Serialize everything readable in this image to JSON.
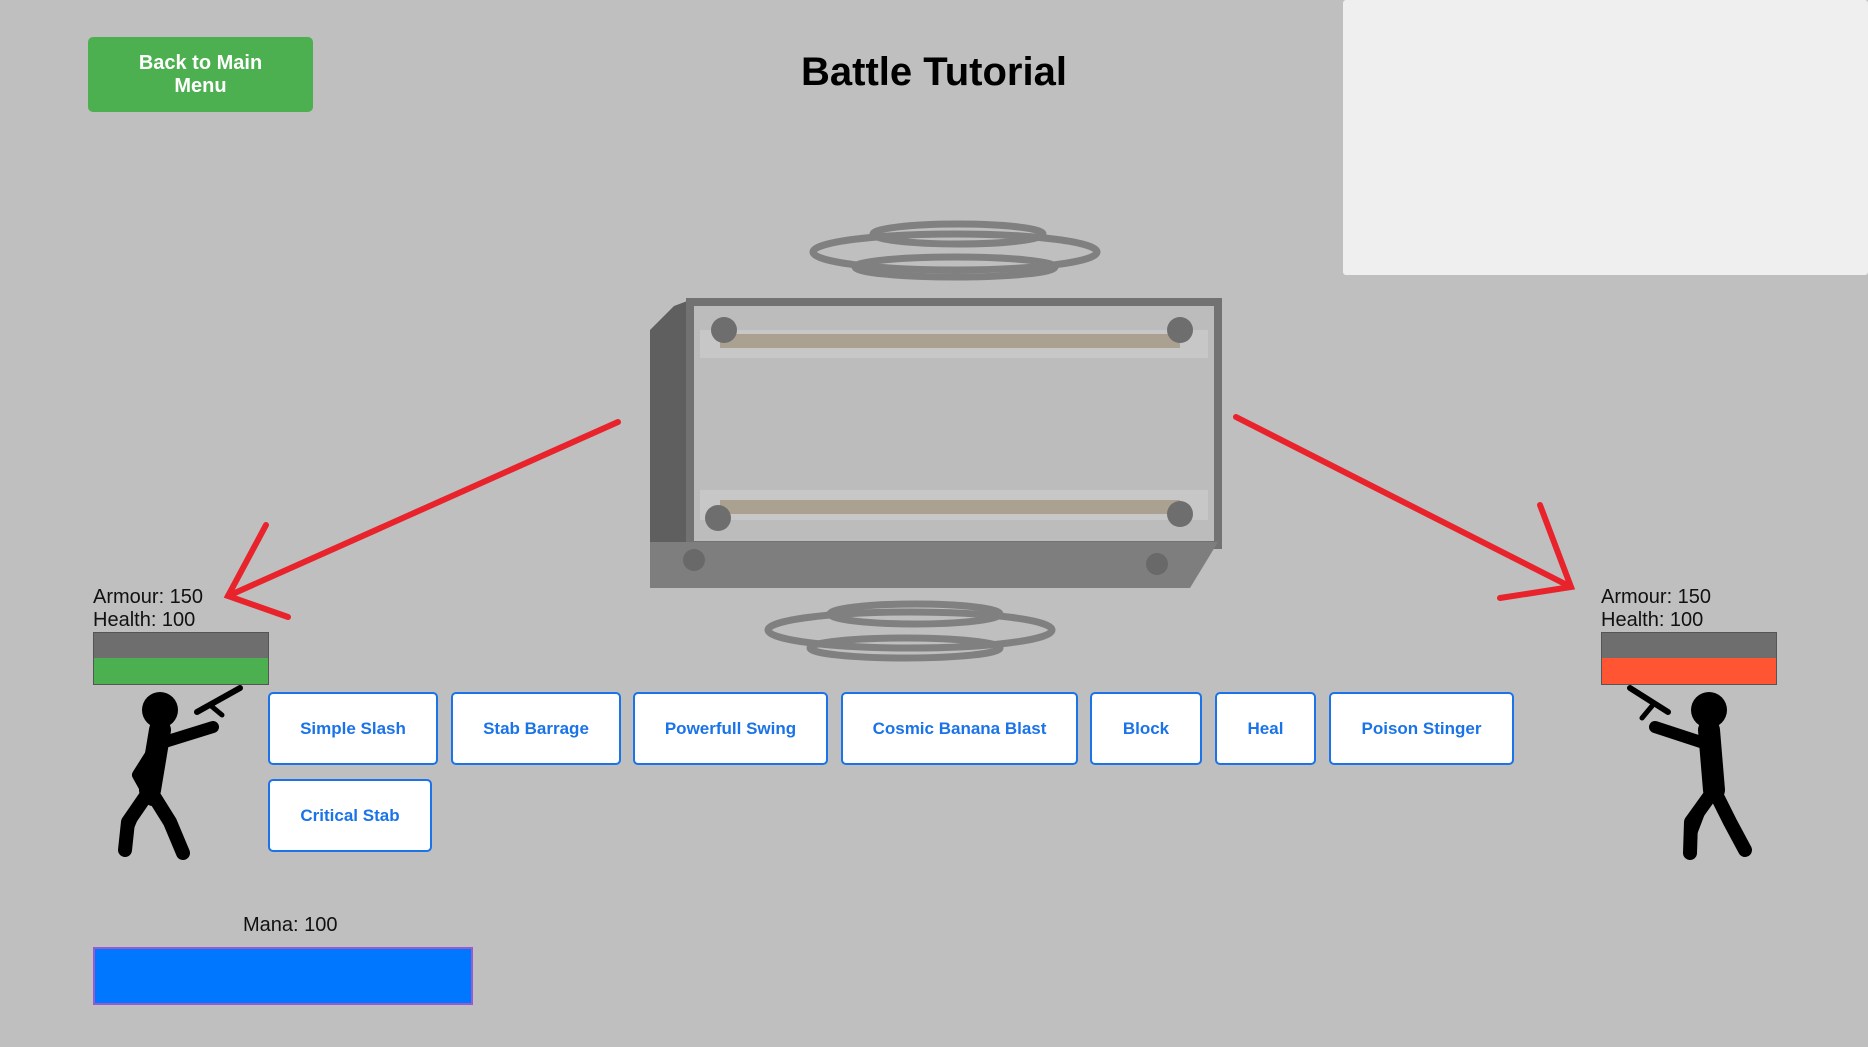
{
  "header": {
    "back_label": "Back to Main Menu",
    "title": "Battle Tutorial"
  },
  "player": {
    "armour_text": "Armour: 150",
    "health_text": "Health: 100",
    "health_fraction": 1.0,
    "health_color": "#4caf50"
  },
  "enemy": {
    "armour_text": "Armour: 150",
    "health_text": "Health: 100",
    "health_fraction": 1.0,
    "health_color": "#ff5533"
  },
  "moves": [
    {
      "label": "Simple Slash"
    },
    {
      "label": "Stab Barrage"
    },
    {
      "label": "Powerfull Swing"
    },
    {
      "label": "Cosmic Banana Blast"
    },
    {
      "label": "Block"
    },
    {
      "label": "Heal"
    },
    {
      "label": "Poison Stinger"
    },
    {
      "label": "Critical Stab"
    }
  ],
  "mana": {
    "text": "Mana: 100",
    "fraction": 1.0,
    "color": "#0077ff"
  },
  "colors": {
    "background": "#bfbfbf",
    "arrow": "#e8232b",
    "move_button_accent": "#1a73e8"
  },
  "icons": [
    "player-stickman-icon",
    "enemy-stickman-icon",
    "treasure-chest-icon",
    "red-arrow-icon"
  ]
}
